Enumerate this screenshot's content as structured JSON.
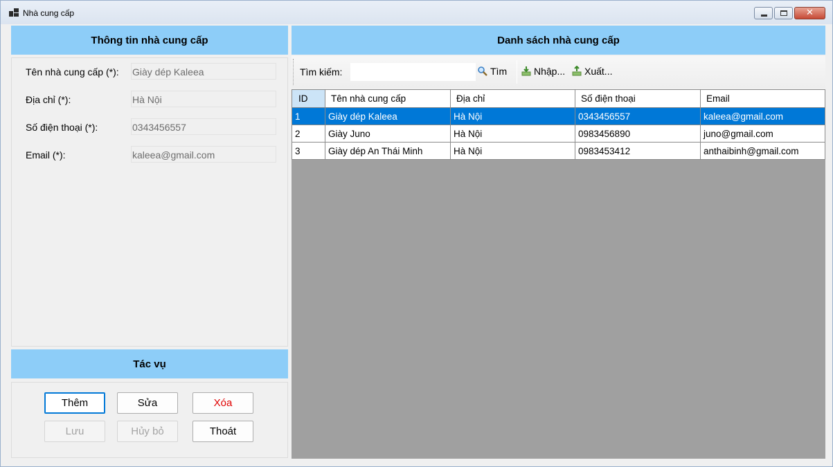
{
  "window": {
    "title": "Nhà cung cấp"
  },
  "info_panel": {
    "header": "Thông tin nhà cung cấp",
    "fields": [
      {
        "label": "Tên nhà cung cấp (*):",
        "value": "Giày dép Kaleea"
      },
      {
        "label": "Địa chỉ (*):",
        "value": "Hà Nội"
      },
      {
        "label": "Số điện thoại (*):",
        "value": "0343456557"
      },
      {
        "label": "Email (*):",
        "value": "kaleea@gmail.com"
      }
    ]
  },
  "actions_panel": {
    "header": "Tác vụ",
    "buttons": {
      "add": "Thêm",
      "edit": "Sửa",
      "delete": "Xóa",
      "save": "Lưu",
      "cancel": "Hủy bỏ",
      "exit": "Thoát"
    },
    "delete_color": "#e00000"
  },
  "list_panel": {
    "header": "Danh sách nhà cung cấp",
    "toolbar": {
      "search_label": "Tìm kiếm:",
      "search_value": "",
      "find": "Tìm",
      "import": "Nhập...",
      "export": "Xuất..."
    },
    "columns": [
      "ID",
      "Tên nhà cung cấp",
      "Địa chỉ",
      "Số điện thoại",
      "Email"
    ],
    "rows": [
      [
        "1",
        "Giày dép Kaleea",
        "Hà Nội",
        "0343456557",
        "kaleea@gmail.com"
      ],
      [
        "2",
        "Giày Juno",
        "Hà Nội",
        "0983456890",
        "juno@gmail.com"
      ],
      [
        "3",
        "Giày dép An Thái Minh",
        "Hà Nội",
        "0983453412",
        "anthaibinh@gmail.com"
      ]
    ],
    "selected_row": 0
  },
  "colors": {
    "header_bg": "#8dcdf8",
    "selection": "#0078d7",
    "grid_bg": "#a0a0a0"
  }
}
